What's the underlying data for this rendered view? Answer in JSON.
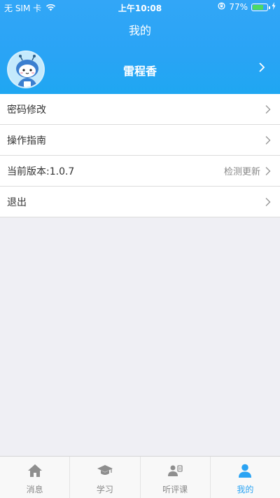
{
  "status_bar": {
    "carrier": "无 SIM 卡",
    "time": "上午10:08",
    "battery_percent": "77%",
    "battery_level": 0.77
  },
  "header": {
    "title": "我的"
  },
  "profile": {
    "name": "雷程香"
  },
  "menu": {
    "items": [
      {
        "label": "密码修改"
      },
      {
        "label": "操作指南"
      },
      {
        "label": "当前版本:1.0.7",
        "extra": "检测更新"
      },
      {
        "label": "退出"
      }
    ]
  },
  "tabbar": {
    "tabs": [
      {
        "label": "消息",
        "icon": "home-icon"
      },
      {
        "label": "学习",
        "icon": "graduation-cap-icon"
      },
      {
        "label": "听评课",
        "icon": "listen-review-icon"
      },
      {
        "label": "我的",
        "icon": "user-icon",
        "active": true
      }
    ]
  },
  "colors": {
    "header_top": "#32a6f7",
    "header_bottom": "#1fa7f2",
    "accent": "#2aa3f3",
    "inactive": "#888888",
    "battery": "#4cd964"
  }
}
